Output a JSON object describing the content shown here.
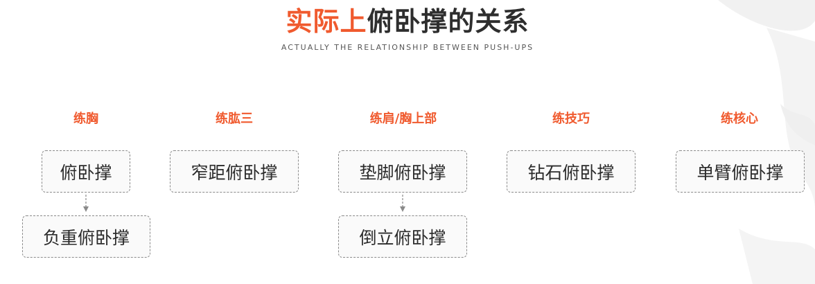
{
  "title": {
    "highlight": "实际上",
    "rest": "俯卧撑的关系"
  },
  "subtitle": "ACTUALLY THE RELATIONSHIP BETWEEN PUSH-UPS",
  "accent_color": "#f05a2e",
  "columns": [
    {
      "heading": "练胸",
      "boxes": [
        "俯卧撑",
        "负重俯卧撑"
      ]
    },
    {
      "heading": "练肱三",
      "boxes": [
        "窄距俯卧撑"
      ]
    },
    {
      "heading": "练肩/胸上部",
      "boxes": [
        "垫脚俯卧撑",
        "倒立俯卧撑"
      ]
    },
    {
      "heading": "练技巧",
      "boxes": [
        "钻石俯卧撑"
      ]
    },
    {
      "heading": "练核心",
      "boxes": [
        "单臂俯卧撑"
      ]
    }
  ]
}
